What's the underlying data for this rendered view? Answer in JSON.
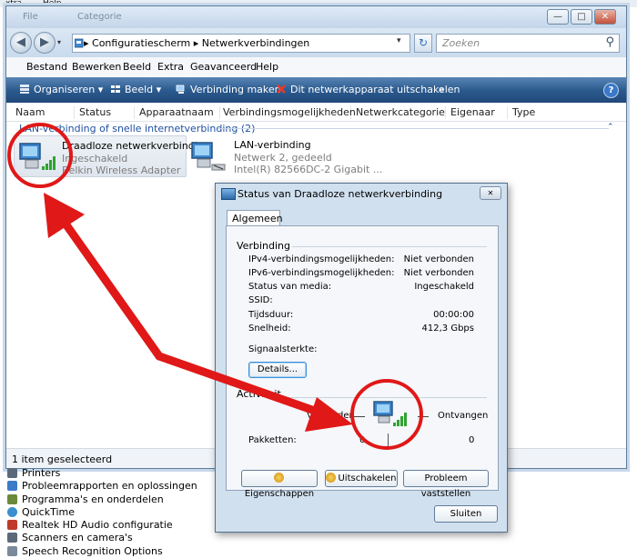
{
  "background_menu": [
    "xtra",
    "Help"
  ],
  "window": {
    "title_ghost_left": "File",
    "title_ghost_right": "Categorie",
    "controls": {
      "minimize": "—",
      "maximize": "□",
      "close": "✕"
    }
  },
  "address": {
    "path": "▸  Configuratiescherm  ▸  Netwerkverbindingen",
    "dropdown": "▾",
    "refresh": "↻",
    "search_placeholder": "Zoeken",
    "search_icon": "⚲"
  },
  "menu": [
    "Bestand",
    "Bewerken",
    "Beeld",
    "Extra",
    "Geavanceerd",
    "Help"
  ],
  "commands": {
    "organize": "Organiseren ▾",
    "view": "Beeld ▾",
    "connect": "Verbinding maken",
    "disable": "Dit netwerkapparaat uitschakelen",
    "more": "»",
    "help": "?"
  },
  "columns": [
    "Naam",
    "Status",
    "Apparaatnaam",
    "Verbindingsmogelijkheden",
    "Netwerkcategorie",
    "Eigenaar",
    "Type"
  ],
  "group": {
    "label": "LAN-verbinding of snelle internetverbinding (2)",
    "chevron": "⌃"
  },
  "items": [
    {
      "name": "Draadloze netwerkverbinding",
      "status": "Ingeschakeld",
      "device": "Belkin Wireless Adapter",
      "selected": true
    },
    {
      "name": "LAN-verbinding",
      "status": "Netwerk  2, gedeeld",
      "device": "Intel(R) 82566DC-2 Gigabit ...",
      "selected": false
    }
  ],
  "statusbar": "1 item geselecteerd",
  "background_list": [
    {
      "label": "Printers",
      "color": "#5a6a7a"
    },
    {
      "label": "Probleemrapporten en oplossingen",
      "color": "#3b7bc8"
    },
    {
      "label": "Programma's en onderdelen",
      "color": "#6a8a3a"
    },
    {
      "label": "QuickTime",
      "color": "#3a8fd0"
    },
    {
      "label": "Realtek HD Audio configuratie",
      "color": "#c0392b"
    },
    {
      "label": "Scanners en camera's",
      "color": "#5a6a7a"
    },
    {
      "label": "Speech Recognition Options",
      "color": "#7a8a9a"
    }
  ],
  "dialog": {
    "title": "Status van Draadloze netwerkverbinding",
    "close": "✕",
    "tab": "Algemeen",
    "connection_header": "Verbinding",
    "rows": [
      {
        "label": "IPv4-verbindingsmogelijkheden:",
        "value": "Niet verbonden"
      },
      {
        "label": "IPv6-verbindingsmogelijkheden:",
        "value": "Niet verbonden"
      },
      {
        "label": "Status van media:",
        "value": "Ingeschakeld"
      },
      {
        "label": "SSID:",
        "value": ""
      },
      {
        "label": "Tijdsduur:",
        "value": "00:00:00"
      },
      {
        "label": "Snelheid:",
        "value": "412,3 Gbps"
      }
    ],
    "signal_label": "Signaalsterkte:",
    "details_button": "Details...",
    "activity_header": "Activiteit",
    "sent_label": "Verzonden",
    "received_label": "Ontvangen",
    "packets_label": "Pakketten:",
    "packets_sent": "0",
    "packets_received": "0",
    "buttons": {
      "properties": "Eigenschappen",
      "disable": "Uitschakelen",
      "diagnose": "Probleem vaststellen",
      "close": "Sluiten"
    }
  },
  "colors": {
    "annotation_red": "#e01818",
    "command_bar": "#2c5b8f",
    "group_blue": "#1f4fa1",
    "signal_green": "#2fa32f"
  }
}
